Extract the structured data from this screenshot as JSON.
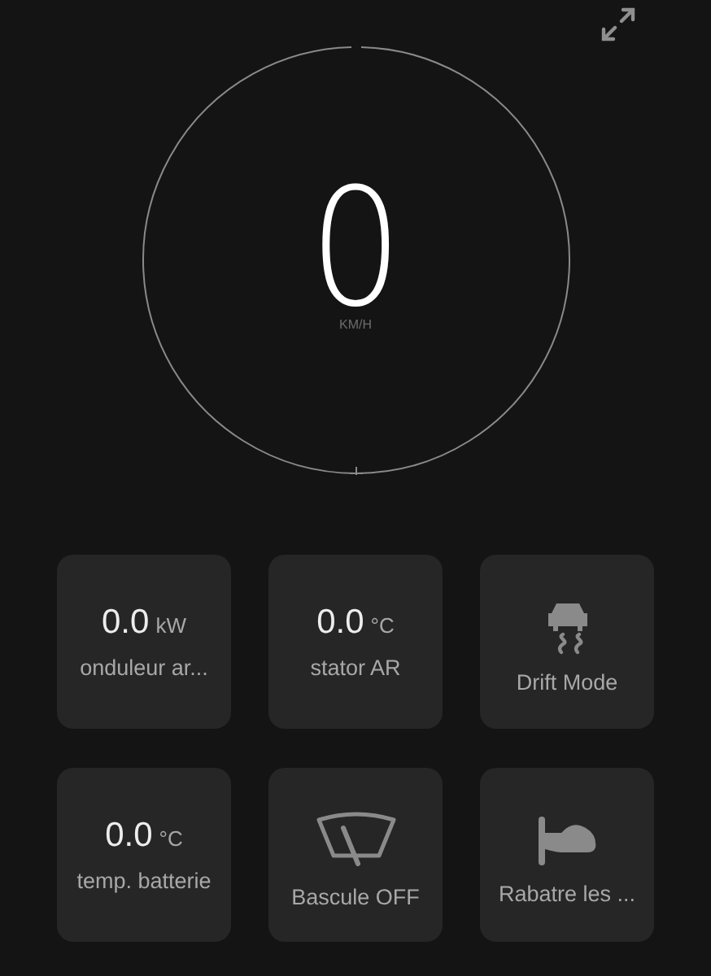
{
  "speed": {
    "value": "0",
    "unit": "KM/H"
  },
  "tiles": [
    {
      "kind": "reading",
      "value": "0.0",
      "unit": "kW",
      "label": "onduleur ar..."
    },
    {
      "kind": "reading",
      "value": "0.0",
      "unit": "°C",
      "label": "stator AR"
    },
    {
      "kind": "drift",
      "label": "Drift Mode"
    },
    {
      "kind": "reading",
      "value": "0.0",
      "unit": "°C",
      "label": "temp. batterie"
    },
    {
      "kind": "wiper",
      "label": "Bascule OFF"
    },
    {
      "kind": "mirror",
      "label": "Rabatre les ..."
    }
  ]
}
